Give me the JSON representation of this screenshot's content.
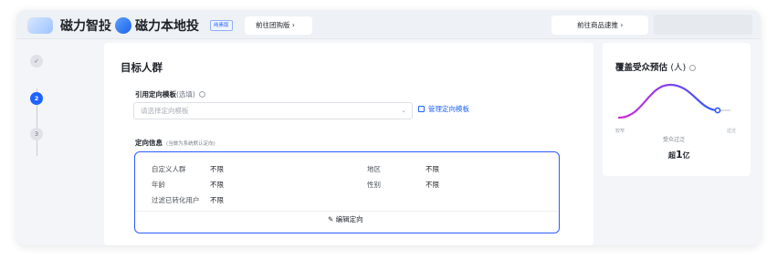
{
  "header": {
    "app_title": "磁力智投",
    "local_title": "磁力本地投",
    "tag": "纯素版",
    "tuangou_link": "前往团购版 ›",
    "goods_link": "前往商品速推 ›"
  },
  "steps": [
    {
      "label": "✓",
      "state": "done"
    },
    {
      "label": "2",
      "state": "active"
    },
    {
      "label": "3",
      "state": "todo"
    }
  ],
  "main": {
    "section_title": "目标人群",
    "template_label": "引用定向模板",
    "template_optional": "(选填)",
    "template_placeholder": "请选择定向模板",
    "manage_link": "管理定向模板",
    "targeting_label": "定向信息",
    "targeting_hint": "(当做为系统默认定向)",
    "rows": [
      {
        "key": "自定义人群",
        "value": "不限"
      },
      {
        "key": "年龄",
        "value": "不限"
      },
      {
        "key": "过滤已转化用户",
        "value": "不限"
      },
      {
        "key": "地区",
        "value": "不限"
      },
      {
        "key": "性别",
        "value": "不限"
      }
    ],
    "edit_label": "✎ 编辑定向"
  },
  "side": {
    "title": "覆盖受众预估",
    "unit": "(人)",
    "axis_left": "较窄",
    "axis_right": "过泛",
    "axis_center": "受众过泛",
    "estimate_prefix": "超",
    "estimate_number": "1",
    "estimate_suffix": "亿",
    "colors": {
      "curve_start": "#d62bd6",
      "curve_end": "#2f5bff"
    }
  }
}
